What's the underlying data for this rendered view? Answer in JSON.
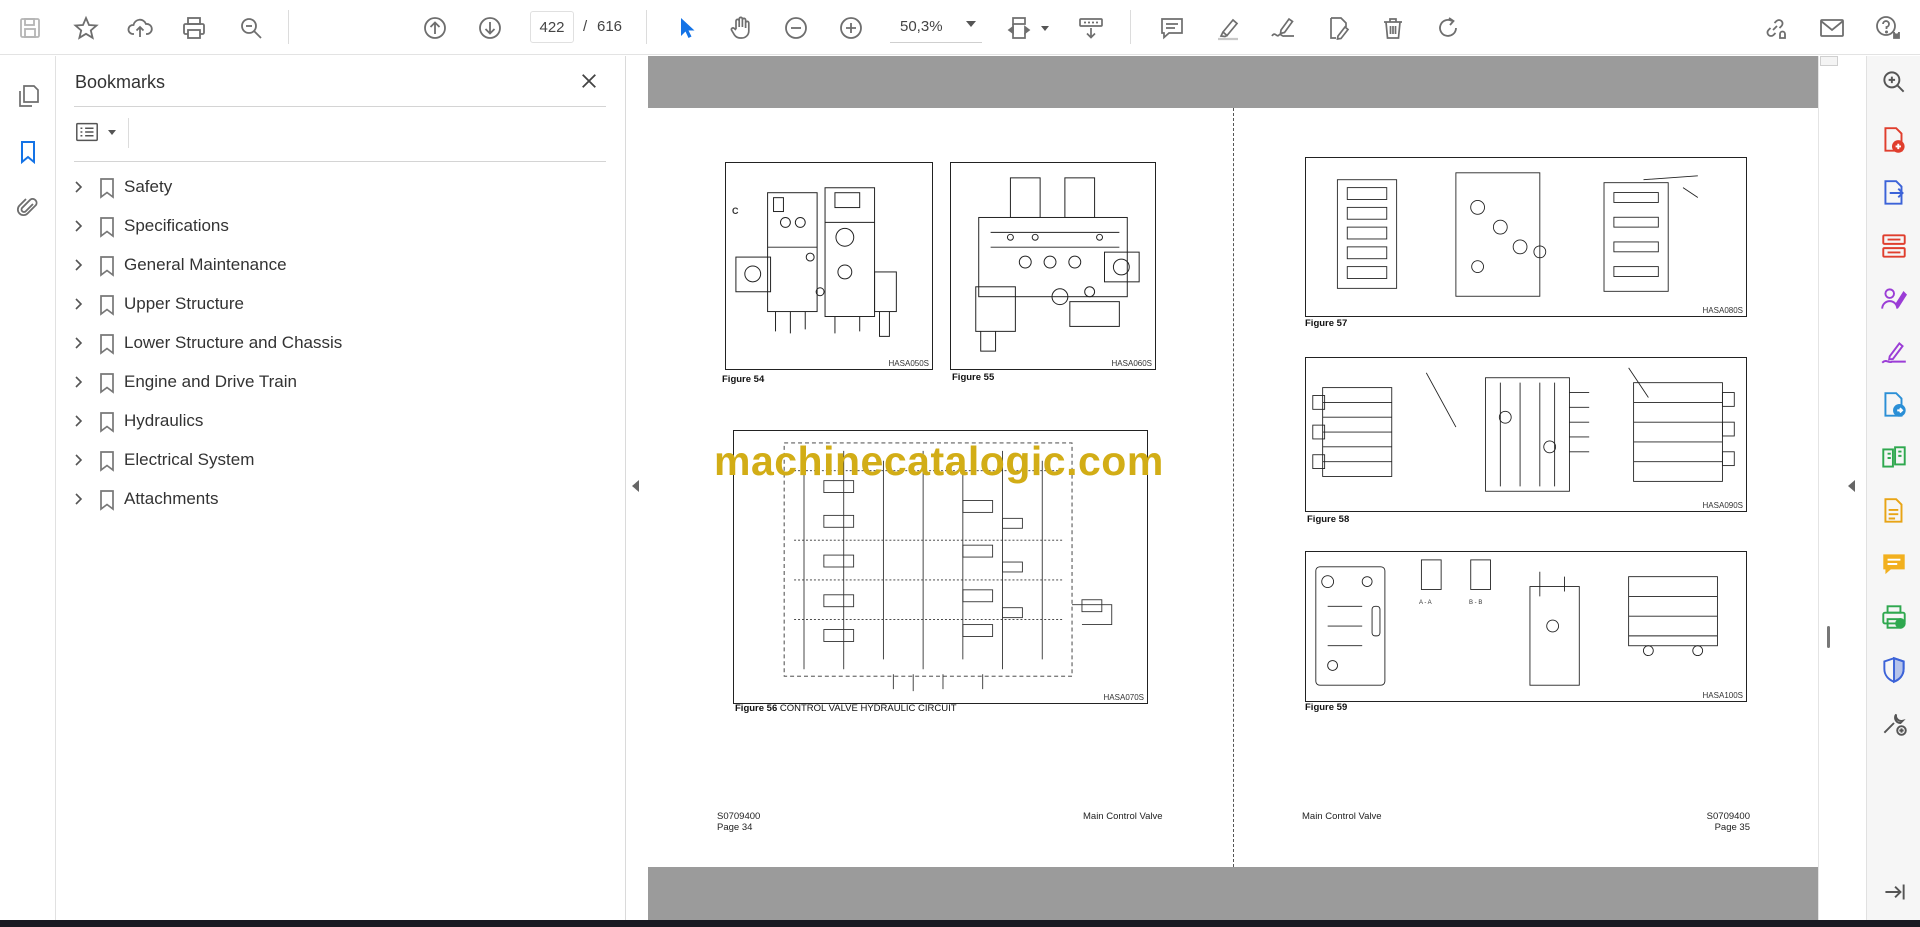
{
  "toolbar": {
    "current_page": "422",
    "page_separator": "/",
    "total_pages": "616",
    "zoom": "50,3%"
  },
  "bookmarks": {
    "title": "Bookmarks",
    "items": [
      {
        "label": "Safety"
      },
      {
        "label": "Specifications"
      },
      {
        "label": "General Maintenance"
      },
      {
        "label": "Upper Structure"
      },
      {
        "label": "Lower Structure and Chassis"
      },
      {
        "label": "Engine and Drive Train"
      },
      {
        "label": "Hydraulics"
      },
      {
        "label": "Electrical System"
      },
      {
        "label": "Attachments"
      }
    ]
  },
  "document": {
    "left_page": {
      "figures": [
        {
          "caption": "Figure 54",
          "code": "HASA050S",
          "label": "C"
        },
        {
          "caption": "Figure 55",
          "code": "HASA060S"
        },
        {
          "caption": "Figure 56",
          "caption_text": "CONTROL VALVE HYDRAULIC CIRCUIT",
          "code": "HASA070S"
        }
      ],
      "footer_left_line1": "S0709400",
      "footer_left_line2": "Page 34",
      "footer_right": "Main Control Valve"
    },
    "right_page": {
      "figures": [
        {
          "caption": "Figure 57",
          "code": "HASA080S"
        },
        {
          "caption": "Figure 58",
          "code": "HASA090S"
        },
        {
          "caption": "Figure 59",
          "code": "HASA100S",
          "labels": [
            "A - A",
            "B - B"
          ]
        }
      ],
      "footer_left": "Main Control Valve",
      "footer_right_line1": "S0709400",
      "footer_right_line2": "Page 35"
    },
    "watermark": "machinecatalogic.com"
  },
  "colors": {
    "accent_blue": "#1473e6",
    "icon_gray": "#6e6e6e",
    "page_gray": "#9b9b9b",
    "watermark": "#d2ad16"
  },
  "icons": {
    "toolbar": [
      "save-icon",
      "star-icon",
      "upload-cloud-icon",
      "print-icon",
      "zoom-search-icon",
      "page-up-icon",
      "page-down-icon",
      "select-arrow-icon",
      "hand-icon",
      "zoom-out-icon",
      "zoom-in-icon",
      "fit-page-icon",
      "scroll-mode-icon",
      "comment-icon",
      "highlight-icon",
      "sign-icon",
      "edit-pdf-icon",
      "delete-icon",
      "rotate-icon",
      "share-link-icon",
      "email-icon",
      "help-account-icon"
    ],
    "right_rail": [
      "zoom-tool-icon",
      "create-pdf-icon",
      "export-pdf-icon",
      "organize-pages-icon",
      "request-signature-icon",
      "fill-sign-icon",
      "send-for-review-icon",
      "compare-icon",
      "scan-icon",
      "comment-tool-icon",
      "print-production-icon",
      "protect-icon",
      "more-tools-icon",
      "expand-panel-icon"
    ]
  }
}
